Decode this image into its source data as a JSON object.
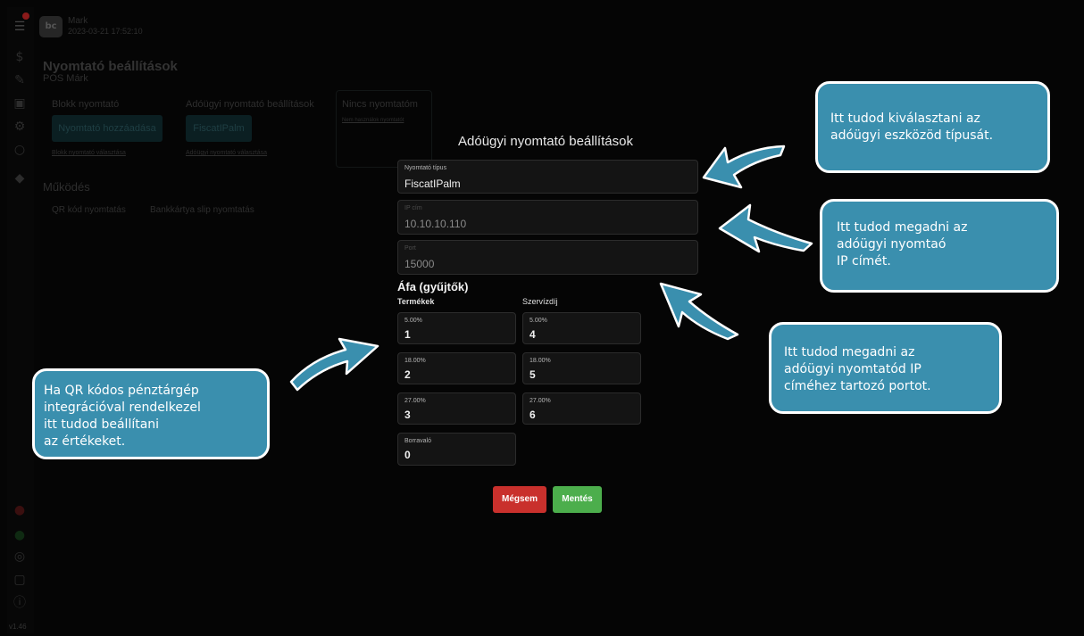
{
  "header": {
    "user_name": "Mark",
    "datetime": "2023-03-21  17:52:10"
  },
  "page": {
    "title": "Nyomtató beállítások",
    "subtitle": "POS Márk",
    "receipt_printer": {
      "heading": "Blokk nyomtató",
      "button": "Nyomtató hozzáadása",
      "link": "Blokk nyomtató választása"
    },
    "fiscal_printer": {
      "heading": "Adóügyi nyomtató beállítások",
      "button": "FiscatIPalm",
      "link": "Adóügyi nyomtató választása"
    },
    "no_printer": {
      "heading": "Nincs nyomtatóm",
      "link": "Nem használok nyomtatót"
    },
    "operation": {
      "heading": "Működés",
      "qr_print": "QR kód nyomtatás",
      "card_slip_print": "Bankkártya slip nyomtatás"
    }
  },
  "dialog": {
    "title": "Adóügyi nyomtató beállítások",
    "printer_type": {
      "label": "Nyomtató típus",
      "value": "FiscatIPalm"
    },
    "ip": {
      "label": "IP cím",
      "value": "10.10.10.110"
    },
    "port": {
      "label": "Port",
      "value": "15000"
    },
    "vat_heading": "Áfa (gyűjtők)",
    "products_heading": "Termékek",
    "service_heading": "Szervízdíj",
    "products": [
      {
        "label": "5.00%",
        "value": "1"
      },
      {
        "label": "18.00%",
        "value": "2"
      },
      {
        "label": "27.00%",
        "value": "3"
      }
    ],
    "service": [
      {
        "label": "5.00%",
        "value": "4"
      },
      {
        "label": "18.00%",
        "value": "5"
      },
      {
        "label": "27.00%",
        "value": "6"
      }
    ],
    "tip": {
      "label": "Borravaló",
      "value": "0"
    },
    "cancel_label": "Mégsem",
    "save_label": "Mentés"
  },
  "callouts": {
    "printer_type": "Itt tudod kiválasztani az\nadóügyi eszközöd típusát.",
    "ip": "Itt tudod megadni az\nadóügyi nyomtaó\nIP címét.",
    "port": "Itt tudod megadni az\nadóügyi nyomtatód IP\ncíméhez tartozó portot.",
    "qr": "Ha QR kódos pénztárgép\nintegrációval rendelkezel\nitt tudod beállítani\naz értékeket."
  },
  "footer": {
    "version": "v1.46"
  },
  "colors": {
    "callout": "#3a8fae",
    "cancel": "#c9302c",
    "save": "#4cae4c",
    "field_bg": "#141414"
  }
}
